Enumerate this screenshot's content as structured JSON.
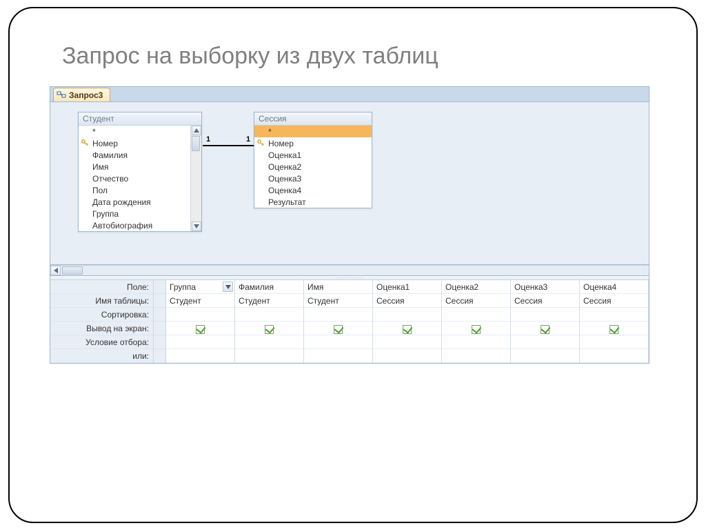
{
  "title": "Запрос на выборку из двух таблиц",
  "tab": {
    "label": "Запрос3"
  },
  "tables": {
    "student": {
      "title": "Студент",
      "fields": [
        "*",
        "Номер",
        "Фамилия",
        "Имя",
        "Отчество",
        "Пол",
        "Дата рождения",
        "Группа",
        "Автобиография"
      ],
      "key_index": 1
    },
    "session": {
      "title": "Сессия",
      "fields": [
        "*",
        "Номер",
        "Оценка1",
        "Оценка2",
        "Оценка3",
        "Оценка4",
        "Результат"
      ],
      "key_index": 1,
      "selected_index": 0
    }
  },
  "relation": {
    "left": "1",
    "right": "1"
  },
  "row_labels": {
    "field": "Поле:",
    "table": "Имя таблицы:",
    "sort": "Сортировка:",
    "show": "Вывод на экран:",
    "criteria": "Условие отбора:",
    "or": "или:"
  },
  "columns": [
    {
      "field": "Группа",
      "table": "Студент",
      "show": true,
      "active": true
    },
    {
      "field": "Фамилия",
      "table": "Студент",
      "show": true
    },
    {
      "field": "Имя",
      "table": "Студент",
      "show": true
    },
    {
      "field": "Оценка1",
      "table": "Сессия",
      "show": true
    },
    {
      "field": "Оценка2",
      "table": "Сессия",
      "show": true
    },
    {
      "field": "Оценка3",
      "table": "Сессия",
      "show": true
    },
    {
      "field": "Оценка4",
      "table": "Сессия",
      "show": true
    }
  ]
}
